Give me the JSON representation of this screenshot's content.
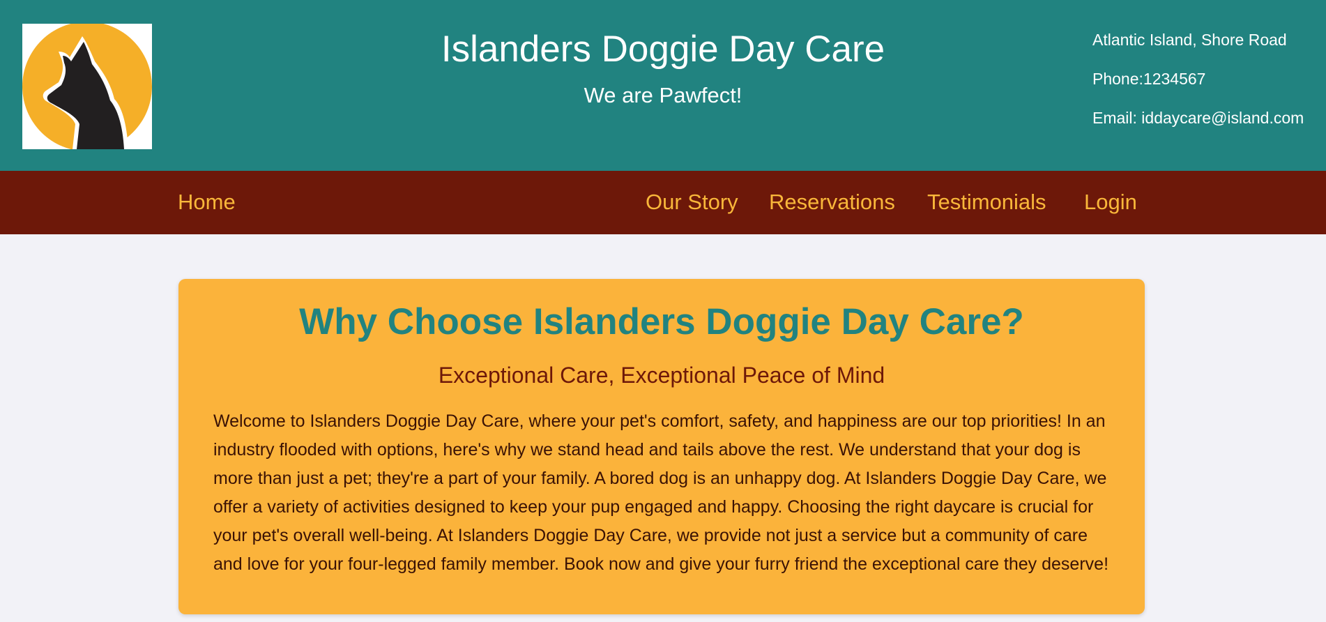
{
  "header": {
    "title": "Islanders Doggie Day Care",
    "tagline": "We are Pawfect!",
    "logo_icon": "dog-silhouette-icon",
    "contact": {
      "address": "Atlantic Island, Shore Road",
      "phone": "Phone:1234567",
      "email": "Email: iddaycare@island.com"
    }
  },
  "nav": {
    "home": "Home",
    "our_story": "Our Story",
    "reservations": "Reservations",
    "testimonials": "Testimonials",
    "login": "Login"
  },
  "main": {
    "heading": "Why Choose Islanders Doggie Day Care?",
    "subheading": "Exceptional Care, Exceptional Peace of Mind",
    "body": "Welcome to Islanders Doggie Day Care, where your pet's comfort, safety, and happiness are our top priorities! In an industry flooded with options, here's why we stand head and tails above the rest. We understand that your dog is more than just a pet; they're a part of your family. A bored dog is an unhappy dog. At Islanders Doggie Day Care, we offer a variety of activities designed to keep your pup engaged and happy. Choosing the right daycare is crucial for your pet's overall well-being. At Islanders Doggie Day Care, we provide not just a service but a community of care and love for your four-legged family member. Book now and give your furry friend the exceptional care they deserve!"
  },
  "colors": {
    "header_bg": "#218380",
    "nav_bg": "#6d1809",
    "nav_link": "#f9b73a",
    "card_bg": "#fbb33b",
    "heading": "#218380",
    "page_bg": "#f2f2f7"
  }
}
